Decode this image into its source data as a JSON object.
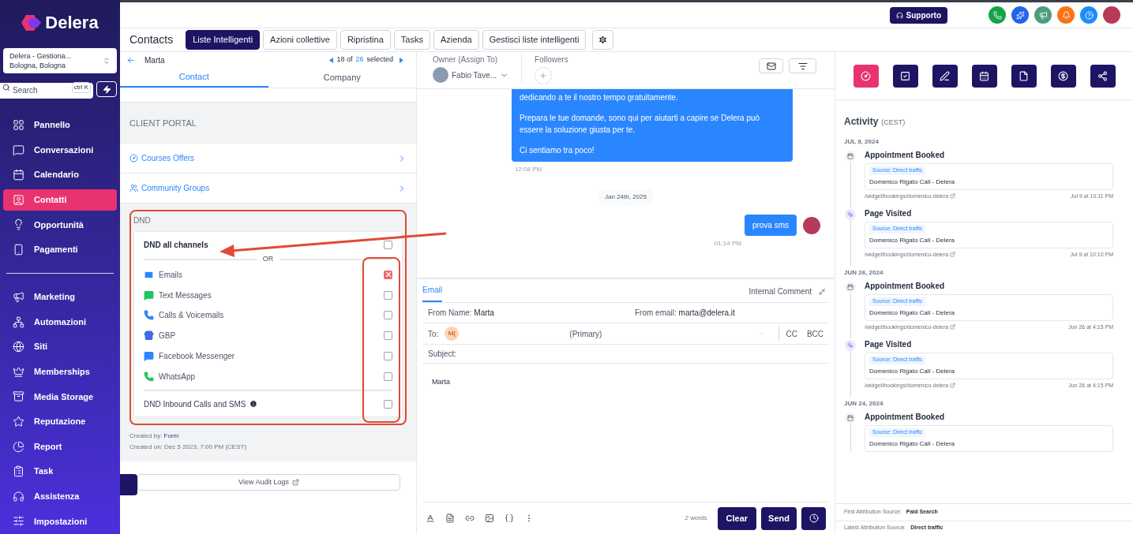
{
  "sidebar": {
    "logo": "Delera",
    "location": {
      "name": "Delera - Gestiona...",
      "city": "Bologna, Bologna"
    },
    "search": {
      "placeholder": "Search",
      "shortcut": "ctrl K"
    },
    "items": [
      {
        "label": "Pannello",
        "selected": false
      },
      {
        "label": "Conversazioni",
        "selected": false
      },
      {
        "label": "Calendario",
        "selected": false
      },
      {
        "label": "Contatti",
        "selected": true
      },
      {
        "label": "Opportunità",
        "selected": false
      },
      {
        "label": "Pagamenti",
        "selected": false
      }
    ],
    "items_2": [
      {
        "label": "Marketing",
        "selected": false
      },
      {
        "label": "Automazioni",
        "selected": false
      },
      {
        "label": "Siti",
        "selected": false
      },
      {
        "label": "Memberships",
        "selected": false
      },
      {
        "label": "Media Storage",
        "selected": false
      },
      {
        "label": "Reputazione",
        "selected": false
      },
      {
        "label": "Report",
        "selected": false
      },
      {
        "label": "Task",
        "selected": false
      },
      {
        "label": "Assistenza",
        "selected": false
      },
      {
        "label": "Impostazioni",
        "selected": false
      }
    ]
  },
  "topbar": {
    "support": "Supporto"
  },
  "toolbar": {
    "title": "Contacts",
    "buttons": [
      {
        "label": "Liste Intelligenti",
        "selected": true
      },
      {
        "label": "Azioni collettive",
        "selected": false
      },
      {
        "label": "Ripristina",
        "selected": false
      },
      {
        "label": "Tasks",
        "selected": false
      },
      {
        "label": "Azienda",
        "selected": false
      },
      {
        "label": "Gestisci liste intelligenti",
        "selected": false
      }
    ]
  },
  "contact_panel": {
    "name": "Marta",
    "pager": {
      "position": "18 of",
      "total": "26",
      "suffix": "selected"
    },
    "tabs": [
      {
        "label": "Contact",
        "selected": true
      },
      {
        "label": "Company",
        "selected": false
      }
    ],
    "section": "CLIENT PORTAL",
    "links": [
      "Courses Offers",
      "Community Groups"
    ],
    "dnd": {
      "title": "DND",
      "all": {
        "label": "DND all channels",
        "checked": false
      },
      "separator": "OR",
      "channels": [
        {
          "label": "Emails",
          "checked": true
        },
        {
          "label": "Text Messages",
          "checked": false
        },
        {
          "label": "Calls & Voicemails",
          "checked": false
        },
        {
          "label": "GBP",
          "checked": false
        },
        {
          "label": "Facebook Messenger",
          "checked": false
        },
        {
          "label": "WhatsApp",
          "checked": false
        }
      ],
      "inbound": {
        "label": "DND Inbound Calls and SMS",
        "checked": false
      }
    },
    "created_by": {
      "label": "Created by:",
      "value": "Form"
    },
    "created_on": "Created on: Dec 5 2023, 7:00 PM (CEST)",
    "audit_button": "View Audit Logs"
  },
  "conversation": {
    "owner_label": "Owner (Assign To)",
    "owner": "Fabio Tave...",
    "followers_label": "Followers",
    "messages": [
      {
        "kind": "incoming_block",
        "paragraphs": [
          "dedicando a te il nostro tempo gratuitamente.",
          "Prepara le tue domande, sono qui per aiutarti a capire se Delera può essere la soluzione giusta per te.",
          "Ci sentiamo tra poco!"
        ],
        "time": "12:08 PM"
      },
      {
        "kind": "date",
        "text": "Jan 24th, 2025"
      },
      {
        "kind": "outgoing",
        "text": "prova sms",
        "time": "01:14 PM"
      }
    ],
    "composer": {
      "tabs": [
        {
          "label": "Email",
          "selected": true
        },
        {
          "label": "Internal Comment",
          "selected": false
        }
      ],
      "from_name": {
        "label": "From Name:",
        "value": "Marta"
      },
      "from_email": {
        "label": "From email:",
        "value": "marta@delera.it"
      },
      "to": {
        "label": "To:",
        "initials": "M(",
        "value": "(Primary)"
      },
      "cc": "CC",
      "bcc": "BCC",
      "subject": {
        "label": "Subject:"
      },
      "body": "Marta",
      "word_count": "2 words",
      "clear": "Clear",
      "send": "Send"
    }
  },
  "activity": {
    "title": "Activity",
    "timezone": "(CEST)",
    "groups": [
      {
        "date": "JUL 9, 2024",
        "events": [
          {
            "kind": "appointment",
            "title": "Appointment Booked",
            "source": "Source: Direct traffic",
            "name": "Domenico Rigato Call - Delera",
            "link": "/widget/bookings/domenico-delera",
            "time": "Jul 9 at 10:11 PM"
          },
          {
            "kind": "page",
            "title": "Page Visited",
            "source": "Source: Direct traffic",
            "name": "Domenico Rigato Call - Delera",
            "link": "/widget/bookings/domenico-delera",
            "time": "Jul 9 at 10:10 PM"
          }
        ]
      },
      {
        "date": "JUN 26, 2024",
        "events": [
          {
            "kind": "appointment",
            "title": "Appointment Booked",
            "source": "Source: Direct traffic",
            "name": "Domenico Rigato Call - Delera",
            "link": "/widget/bookings/domenico-delera",
            "time": "Jun 26 at 4:15 PM"
          },
          {
            "kind": "page",
            "title": "Page Visited",
            "source": "Source: Direct traffic",
            "name": "Domenico Rigato Call - Delera",
            "link": "/widget/bookings/domenico-delera",
            "time": "Jun 26 at 4:15 PM"
          }
        ]
      },
      {
        "date": "JUN 24, 2024",
        "events": [
          {
            "kind": "appointment",
            "title": "Appointment Booked",
            "source": "Source: Direct traffic",
            "name": "Domenico Rigato Call - Delera"
          }
        ]
      }
    ],
    "first_attribution": {
      "label": "First Attribution Source:",
      "value": "Paid Search"
    },
    "latest_attribution": {
      "label": "Latest Attribution Source:",
      "value": "Direct traffic"
    }
  }
}
